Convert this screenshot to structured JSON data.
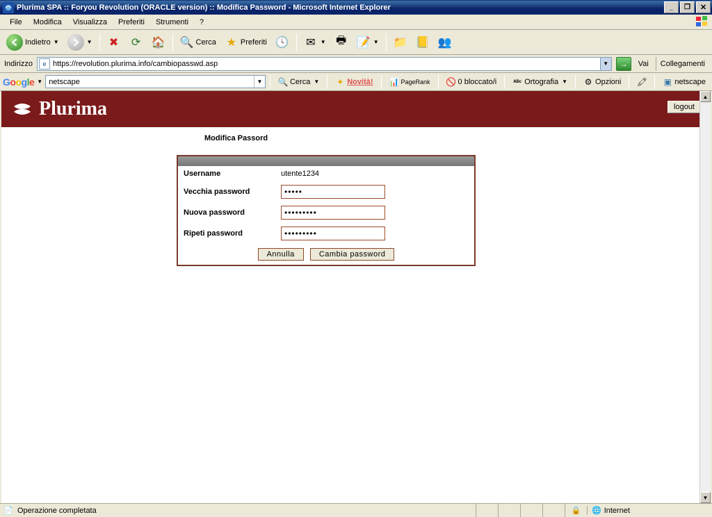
{
  "window": {
    "title": "Plurima SPA :: Foryou Revolution (ORACLE version) :: Modifica Password - Microsoft Internet Explorer"
  },
  "menubar": {
    "items": [
      "File",
      "Modifica",
      "Visualizza",
      "Preferiti",
      "Strumenti",
      "?"
    ]
  },
  "toolbar": {
    "back": "Indietro",
    "search": "Cerca",
    "favorites": "Preferiti"
  },
  "addressbar": {
    "label": "Indirizzo",
    "url": "https://revolution.plurima.info/cambiopasswd.asp",
    "go": "Vai",
    "links": "Collegamenti"
  },
  "google_toolbar": {
    "search_value": "netscape",
    "search_btn": "Cerca",
    "novita": "Novità!",
    "pagerank": "PageRank",
    "blocked": "0 bloccato/i",
    "ortografia": "Ortografia",
    "opzioni": "Opzioni",
    "term": "netscape"
  },
  "plurima": {
    "brand": "Plurima",
    "logout": "logout",
    "page_title": "Modifica Passord",
    "form": {
      "username_label": "Username",
      "username_value": "utente1234",
      "old_pw_label": "Vecchia password",
      "old_pw_value": "•••••",
      "new_pw_label": "Nuova password",
      "new_pw_value": "•••••••••",
      "repeat_pw_label": "Ripeti password",
      "repeat_pw_value": "•••••••••",
      "cancel": "Annulla",
      "submit": "Cambia password"
    }
  },
  "statusbar": {
    "status": "Operazione completata",
    "zone": "Internet"
  }
}
